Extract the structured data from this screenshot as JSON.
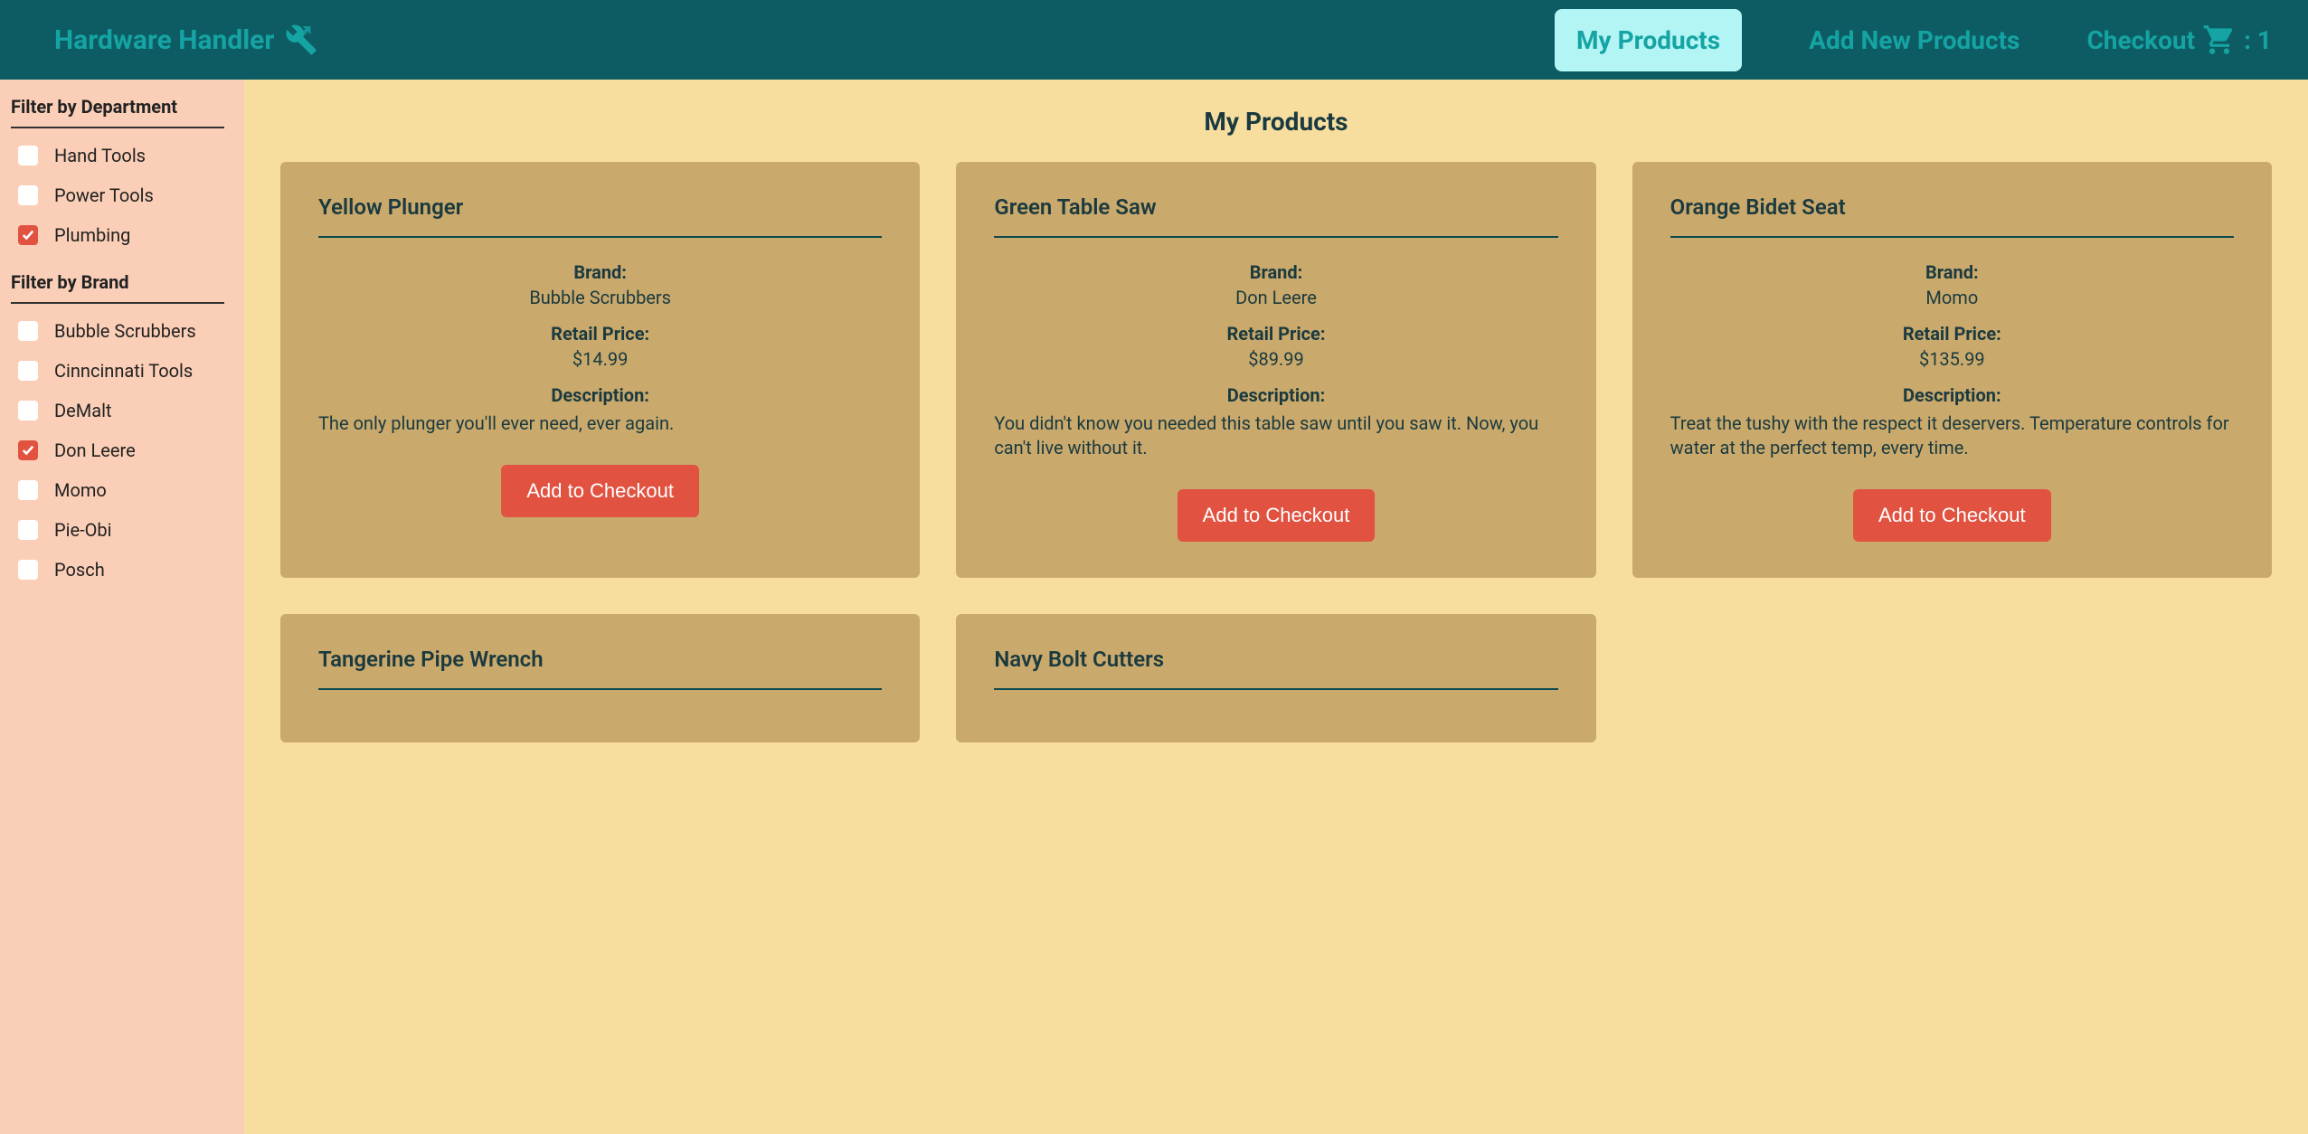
{
  "nav": {
    "brand": "Hardware Handler",
    "links": {
      "products": "My Products",
      "add": "Add New Products",
      "checkout": "Checkout",
      "cart_count": ": 1"
    }
  },
  "sidebar": {
    "dept_heading": "Filter by Department",
    "brand_heading": "Filter by Brand",
    "departments": [
      {
        "label": "Hand Tools",
        "checked": false
      },
      {
        "label": "Power Tools",
        "checked": false
      },
      {
        "label": "Plumbing",
        "checked": true
      }
    ],
    "brands": [
      {
        "label": "Bubble Scrubbers",
        "checked": false
      },
      {
        "label": "Cinncinnati Tools",
        "checked": false
      },
      {
        "label": "DeMalt",
        "checked": false
      },
      {
        "label": "Don Leere",
        "checked": true
      },
      {
        "label": "Momo",
        "checked": false
      },
      {
        "label": "Pie-Obi",
        "checked": false
      },
      {
        "label": "Posch",
        "checked": false
      }
    ]
  },
  "main": {
    "title": "My Products",
    "labels": {
      "brand": "Brand:",
      "price": "Retail Price:",
      "description": "Description:",
      "add_button": "Add to Checkout"
    },
    "products": [
      {
        "name": "Yellow Plunger",
        "brand": "Bubble Scrubbers",
        "price": "$14.99",
        "description": "The only plunger you'll ever need, ever again."
      },
      {
        "name": "Green Table Saw",
        "brand": "Don Leere",
        "price": "$89.99",
        "description": "You didn't know you needed this table saw until you saw it. Now, you can't live without it."
      },
      {
        "name": "Orange Bidet Seat",
        "brand": "Momo",
        "price": "$135.99",
        "description": "Treat the tushy with the respect it deservers. Temperature controls for water at the perfect temp, every time."
      },
      {
        "name": "Tangerine Pipe Wrench",
        "brand": "",
        "price": "",
        "description": ""
      },
      {
        "name": "Navy Bolt Cutters",
        "brand": "",
        "price": "",
        "description": ""
      }
    ]
  }
}
